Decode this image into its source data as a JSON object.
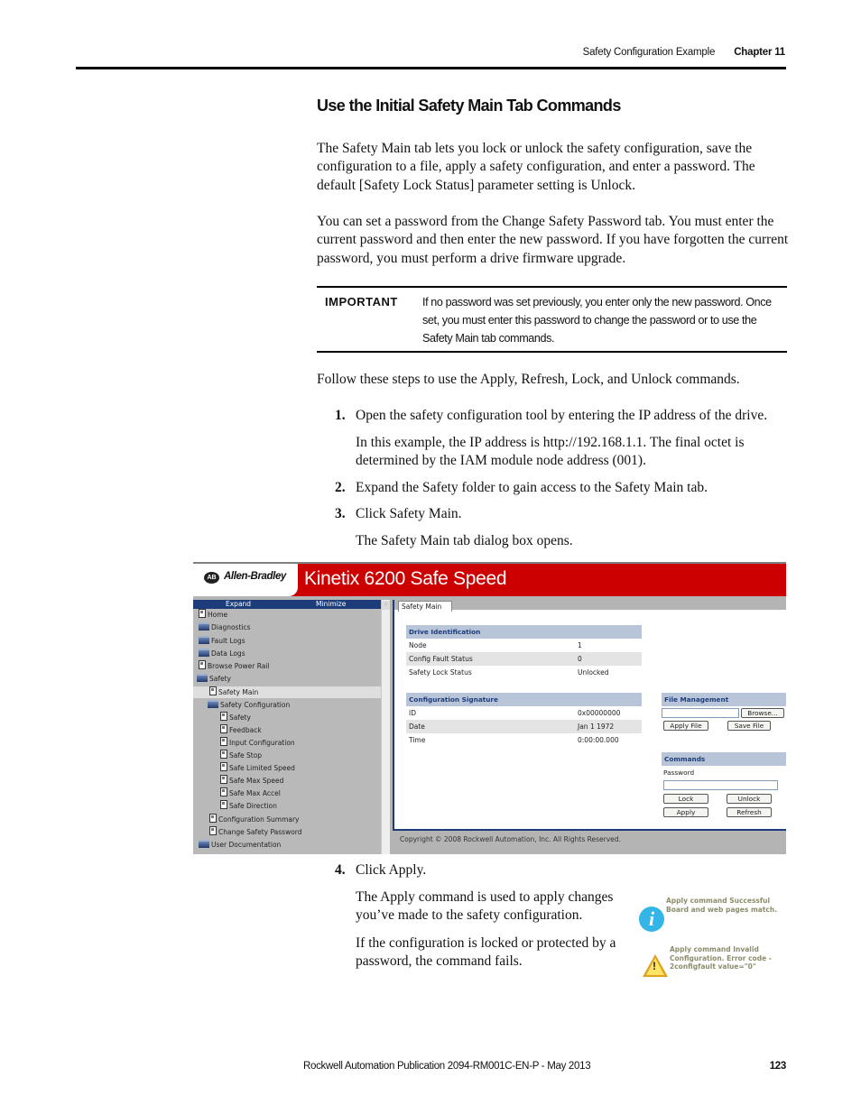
{
  "running_head": {
    "section": "Safety Configuration Example",
    "chapter": "Chapter 11"
  },
  "heading": "Use the Initial Safety Main Tab Commands",
  "paragraphs": [
    "The Safety Main tab lets you lock or unlock the safety configuration, save the configuration to a file, apply a safety configuration, and enter a password. The default [Safety Lock Status] parameter setting is Unlock.",
    "You can set a password from the Change Safety Password tab. You must enter the current password and then enter the new password. If you have forgotten the current password, you must perform a drive firmware upgrade.",
    "Follow these steps to use the Apply, Refresh, Lock, and Unlock commands."
  ],
  "important": {
    "label": "IMPORTANT",
    "text": "If no password was set previously, you enter only the new password. Once set, you must enter this password to change the password or to use the Safety Main tab commands."
  },
  "steps": [
    {
      "num": "1.",
      "text": "Open the safety configuration tool by entering the IP address of the drive.",
      "sub": "In this example, the IP address is http://192.168.1.1. The final octet is determined by the IAM module node address (001)."
    },
    {
      "num": "2.",
      "text": "Expand the Safety folder to gain access to the Safety Main tab."
    },
    {
      "num": "3.",
      "text": "Click Safety Main.",
      "sub": "The Safety Main tab dialog box opens."
    },
    {
      "num": "4.",
      "text": "Click Apply.",
      "sub": "The Apply command is used to apply changes you’ve made to the safety configuration.",
      "sub2": "If the configuration is locked or protected by a password, the command fails."
    }
  ],
  "screenshot": {
    "brand_badge": "AB",
    "brand": "Allen-Bradley",
    "title": "Kinetix 6200 Safe Speed",
    "banner_color": "#cc0000",
    "nav_bar": {
      "expand": "Expand",
      "minimize": "Minimize"
    },
    "nav_items": [
      {
        "label": "Home",
        "icon": "page-icon"
      },
      {
        "label": "Diagnostics",
        "icon": "folder-icon"
      },
      {
        "label": "Fault Logs",
        "icon": "folder-icon"
      },
      {
        "label": "Data Logs",
        "icon": "folder-icon"
      },
      {
        "label": "Browse Power Rail",
        "icon": "page-icon"
      },
      {
        "label": "Safety",
        "icon": "folder-open-icon"
      },
      {
        "label": "Safety Main",
        "icon": "page-icon",
        "selected": true
      },
      {
        "label": "Safety Configuration",
        "icon": "folder-open-icon"
      },
      {
        "label": "Safety",
        "icon": "page-icon"
      },
      {
        "label": "Feedback",
        "icon": "page-icon"
      },
      {
        "label": "Input Configuration",
        "icon": "page-icon"
      },
      {
        "label": "Safe Stop",
        "icon": "page-icon"
      },
      {
        "label": "Safe Limited Speed",
        "icon": "page-icon"
      },
      {
        "label": "Safe Max Speed",
        "icon": "page-icon"
      },
      {
        "label": "Safe Max Accel",
        "icon": "page-icon"
      },
      {
        "label": "Safe Direction",
        "icon": "page-icon"
      },
      {
        "label": "Configuration Summary",
        "icon": "page-icon"
      },
      {
        "label": "Change Safety Password",
        "icon": "page-icon"
      },
      {
        "label": "User Documentation",
        "icon": "folder-icon"
      }
    ],
    "tab": "Safety Main",
    "drive_identification": {
      "header": "Drive Identification",
      "rows": [
        {
          "key": "Node",
          "value": "1"
        },
        {
          "key": "Config Fault Status",
          "value": "0"
        },
        {
          "key": "Safety Lock Status",
          "value": "Unlocked"
        }
      ]
    },
    "configuration_signature": {
      "header": "Configuration Signature",
      "rows": [
        {
          "key": "ID",
          "value": "0x00000000"
        },
        {
          "key": "Date",
          "value": "Jan 1 1972"
        },
        {
          "key": "Time",
          "value": "0:00:00.000"
        }
      ]
    },
    "file_management": {
      "header": "File Management",
      "file_value": "",
      "browse": "Browse...",
      "apply_file": "Apply File",
      "save_file": "Save File"
    },
    "commands": {
      "header": "Commands",
      "password_label": "Password",
      "password_value": "",
      "lock": "Lock",
      "unlock": "Unlock",
      "apply": "Apply",
      "refresh": "Refresh"
    },
    "copyright": "Copyright © 2008 Rockwell Automation, Inc. All Rights Reserved."
  },
  "messages": {
    "success": "Apply command  Successful Board and web pages match.",
    "error": "Apply command  Invalid Configuration. Error code - 2configfault value=\"0\""
  },
  "footer": {
    "publication": "Rockwell Automation Publication 2094-RM001C-EN-P - May 2013",
    "page": "123"
  }
}
